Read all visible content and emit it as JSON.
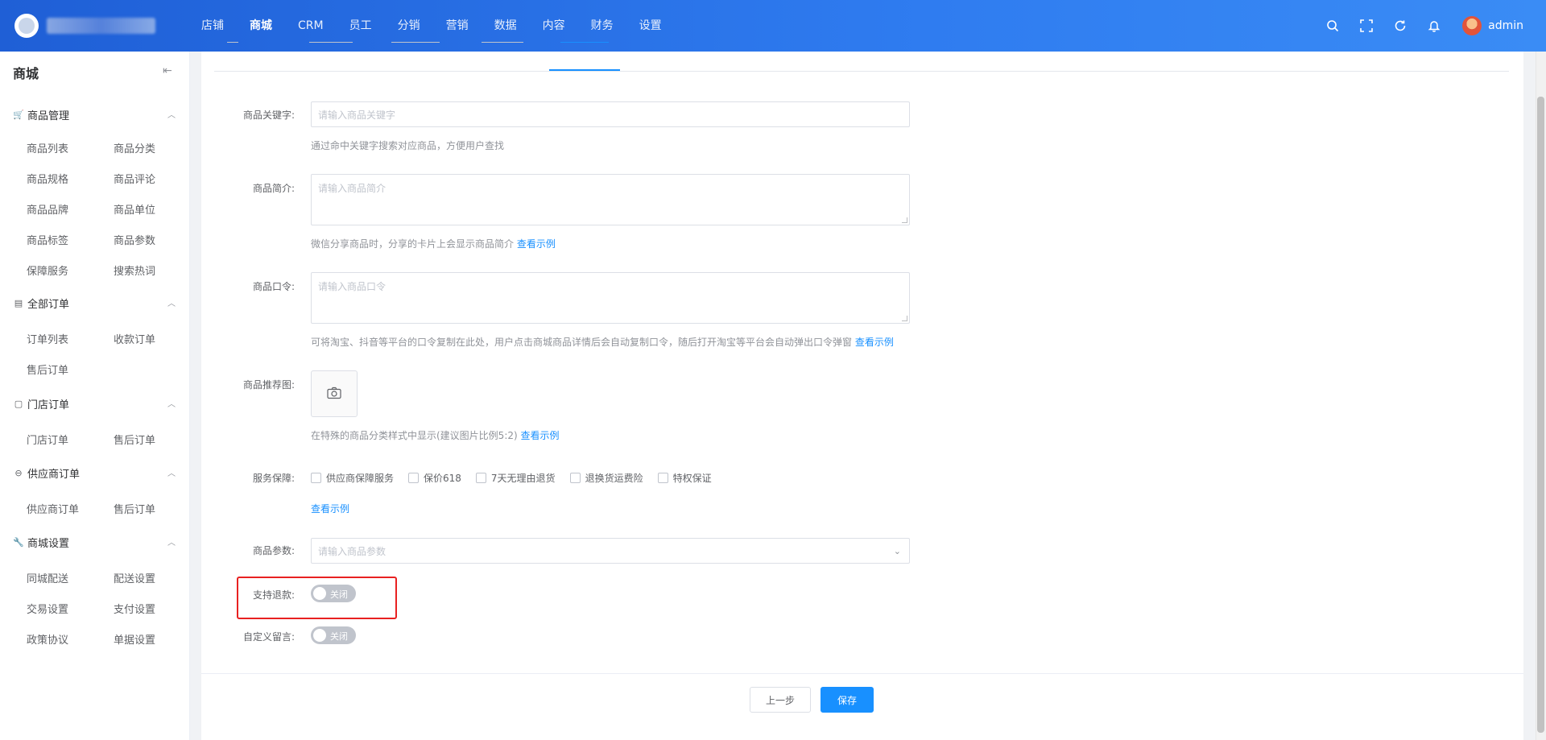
{
  "header": {
    "nav": [
      {
        "label": "店铺",
        "active": false
      },
      {
        "label": "商城",
        "active": true
      },
      {
        "label": "CRM",
        "active": false
      },
      {
        "label": "员工",
        "active": false
      },
      {
        "label": "分销",
        "active": false
      },
      {
        "label": "营销",
        "active": false
      },
      {
        "label": "数据",
        "active": false
      },
      {
        "label": "内容",
        "active": false
      },
      {
        "label": "财务",
        "active": false
      },
      {
        "label": "设置",
        "active": false
      }
    ],
    "username": "admin",
    "icons": [
      "search-icon",
      "fullscreen-icon",
      "refresh-icon",
      "bell-icon"
    ]
  },
  "sidebar": {
    "title": "商城",
    "collapse_icon": "collapse-icon",
    "groups": [
      {
        "label": "商品管理",
        "icon": "cart-icon",
        "items": [
          "商品列表",
          "商品分类",
          "商品规格",
          "商品评论",
          "商品品牌",
          "商品单位",
          "商品标签",
          "商品参数",
          "保障服务",
          "搜索热词"
        ]
      },
      {
        "label": "全部订单",
        "icon": "order-icon",
        "items": [
          "订单列表",
          "收款订单",
          "售后订单"
        ]
      },
      {
        "label": "门店订单",
        "icon": "store-icon",
        "items": [
          "门店订单",
          "售后订单"
        ]
      },
      {
        "label": "供应商订单",
        "icon": "supplier-icon",
        "items": [
          "供应商订单",
          "售后订单"
        ]
      },
      {
        "label": "商城设置",
        "icon": "wrench-icon",
        "items": [
          "同城配送",
          "配送设置",
          "交易设置",
          "支付设置",
          "政策协议",
          "单据设置"
        ]
      }
    ]
  },
  "form": {
    "keyword": {
      "label": "商品关键字:",
      "placeholder": "请输入商品关键字",
      "help": "通过命中关键字搜索对应商品，方便用户查找"
    },
    "intro": {
      "label": "商品简介:",
      "placeholder": "请输入商品简介",
      "help": "微信分享商品时，分享的卡片上会显示商品简介",
      "help_link": "查看示例"
    },
    "code": {
      "label": "商品口令:",
      "placeholder": "请输入商品口令",
      "help": "可将淘宝、抖音等平台的口令复制在此处，用户点击商城商品详情后会自动复制口令，随后打开淘宝等平台会自动弹出口令弹窗",
      "help_link": "查看示例"
    },
    "image": {
      "label": "商品推荐图:",
      "help": "在特殊的商品分类样式中显示(建议图片比例5:2)",
      "help_link": "查看示例"
    },
    "service": {
      "label": "服务保障:",
      "options": [
        "供应商保障服务",
        "保价618",
        "7天无理由退货",
        "退换货运费险",
        "特权保证"
      ],
      "link": "查看示例"
    },
    "params": {
      "label": "商品参数:",
      "placeholder": "请输入商品参数"
    },
    "refund": {
      "label": "支持退款:",
      "switch_text": "关闭"
    },
    "message": {
      "label": "自定义留言:",
      "switch_text": "关闭"
    }
  },
  "footer": {
    "prev_label": "上一步",
    "save_label": "保存"
  }
}
